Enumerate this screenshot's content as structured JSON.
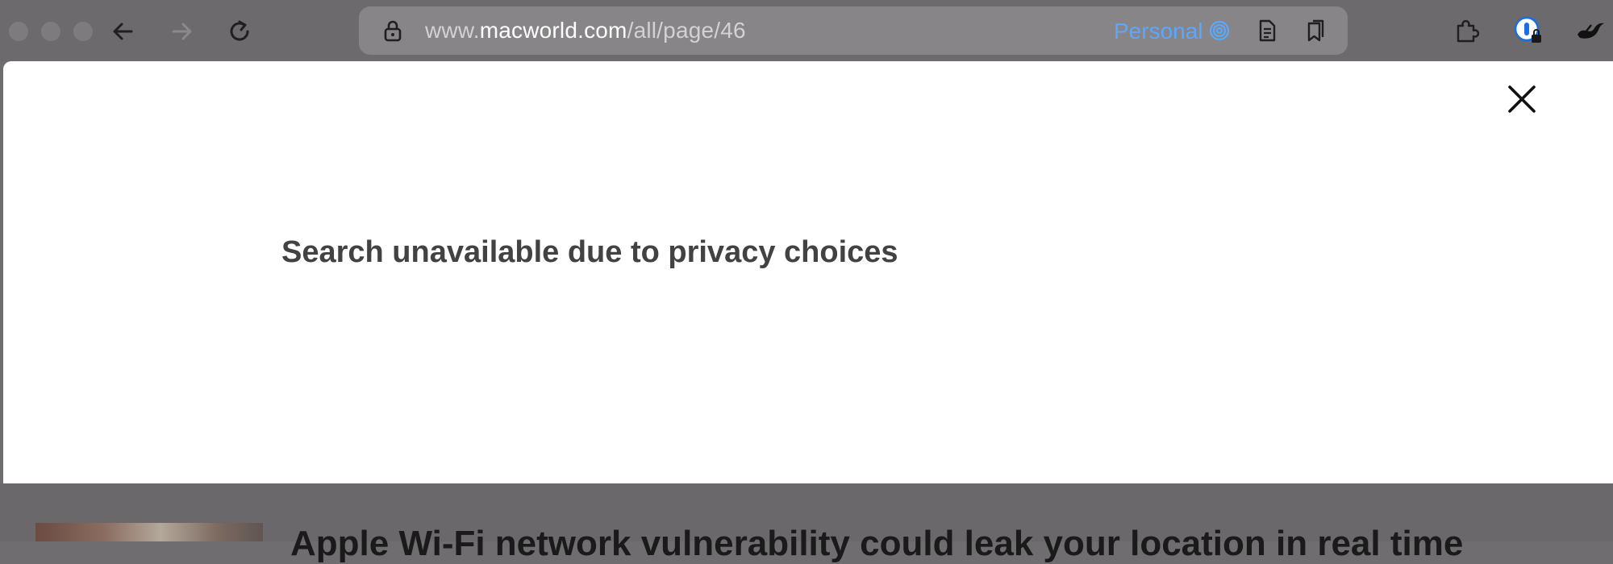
{
  "browser": {
    "url_prefix": "www.",
    "url_host": "macworld.com",
    "url_path": "/all/page/46",
    "profile_label": "Personal",
    "icons": {
      "back": "arrow-left-icon",
      "forward": "arrow-right-icon",
      "reload": "reload-icon",
      "lock": "lock-icon",
      "profile": "profile-fingerprint-icon",
      "reader": "reader-icon",
      "tabs": "tab-overview-icon",
      "extensions": "puzzle-icon",
      "password": "password-manager-icon",
      "extension2": "bird-icon"
    }
  },
  "modal": {
    "message": "Search unavailable due to privacy choices",
    "close_icon": "close-icon"
  },
  "background_article": {
    "headline": "Apple Wi-Fi network vulnerability could leak your location in real time"
  },
  "colors": {
    "profile_accent": "#5aa8ff",
    "page_background": "#ffffff",
    "dimmed_chrome": "#6c6a6c"
  }
}
